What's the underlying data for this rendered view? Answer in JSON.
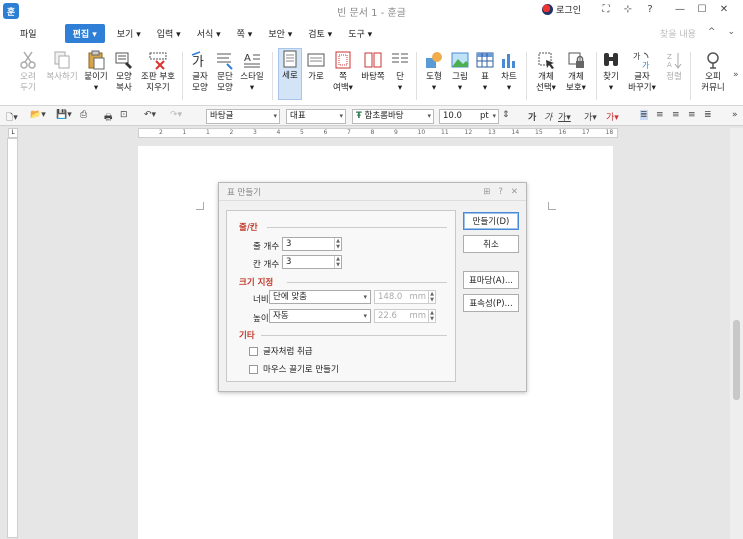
{
  "app": {
    "icon_label": "훈",
    "title": "빈 문서 1 - 훈글"
  },
  "titlebar": {
    "login_label": "로그인",
    "buttons": [
      "⛶",
      "⊹",
      "?",
      "—",
      "☐",
      "✕"
    ]
  },
  "menu": {
    "file": "파일",
    "items": [
      "편집 ▾",
      "보기 ▾",
      "입력 ▾",
      "서식 ▾",
      "쪽 ▾",
      "보안 ▾",
      "검토 ▾",
      "도구 ▾"
    ],
    "right": [
      "찾을 내용",
      "^",
      "⌄"
    ]
  },
  "ribbon": {
    "buttons": [
      {
        "label": "오려\n두기",
        "icon": "scissors-icon"
      },
      {
        "label": "복사하기",
        "icon": "copy-icon"
      },
      {
        "label": "붙이기\n▾",
        "icon": "paste-icon"
      },
      {
        "label": "모양\n복사",
        "icon": "format-painter-icon"
      },
      {
        "label": "조판 부호\n지우기",
        "icon": "clear-format-icon"
      },
      {
        "label": "글자\n모양",
        "icon": "char-shape-icon"
      },
      {
        "label": "문단\n모양",
        "icon": "para-shape-icon"
      },
      {
        "label": "스타일\n▾",
        "icon": "style-icon"
      },
      {
        "label": "세로",
        "icon": "portrait-icon"
      },
      {
        "label": "가로",
        "icon": "landscape-icon"
      },
      {
        "label": "쪽\n여백▾",
        "icon": "margin-icon"
      },
      {
        "label": "바탕쪽",
        "icon": "master-page-icon"
      },
      {
        "label": "단\n▾",
        "icon": "column-icon"
      },
      {
        "label": "도형\n▾",
        "icon": "shape-icon"
      },
      {
        "label": "그림\n▾",
        "icon": "picture-icon"
      },
      {
        "label": "표\n▾",
        "icon": "table-icon"
      },
      {
        "label": "차트\n▾",
        "icon": "chart-icon"
      },
      {
        "label": "개체\n선택▾",
        "icon": "select-object-icon"
      },
      {
        "label": "개체\n보호▾",
        "icon": "object-protect-icon"
      },
      {
        "label": "찾기\n▾",
        "icon": "find-icon"
      },
      {
        "label": "글자\n바꾸기▾",
        "icon": "replace-icon"
      },
      {
        "label": "정렬",
        "icon": "sort-icon"
      },
      {
        "label": "오피\n커뮤니",
        "icon": "community-icon"
      }
    ]
  },
  "format": {
    "style": "바탕글",
    "lang": "대표",
    "font": "함초롬바탕",
    "size": "10.0",
    "unit": "pt"
  },
  "ruler": {
    "top_ticks": [
      "2",
      "1",
      "1",
      "2",
      "3",
      "4",
      "5",
      "6",
      "7",
      "8",
      "9",
      "10",
      "11",
      "12",
      "13",
      "14",
      "15",
      "16",
      "17",
      "18"
    ]
  },
  "dialog": {
    "title": "표 만들기",
    "title_buttons": [
      "⊞",
      "?",
      "✕"
    ],
    "section_rowcol": "줄/칸",
    "rows_label": "줄 개수",
    "rows_value": "3",
    "cols_label": "칸 개수",
    "cols_value": "3",
    "section_size": "크기 지정",
    "width_label": "너비",
    "width_mode": "단에 맞춤",
    "width_value": "148.0",
    "width_unit": "mm",
    "height_label": "높이",
    "height_mode": "자동",
    "height_value": "22.6",
    "height_unit": "mm",
    "section_etc": "기타",
    "chk_char": "글자처럼 취급",
    "chk_mouse": "마우스 끌기로 만들기",
    "btn_create": "만들기(D)",
    "btn_cancel": "취소",
    "btn_table_template": "표마당(A)...",
    "btn_props": "표속성(P)..."
  }
}
